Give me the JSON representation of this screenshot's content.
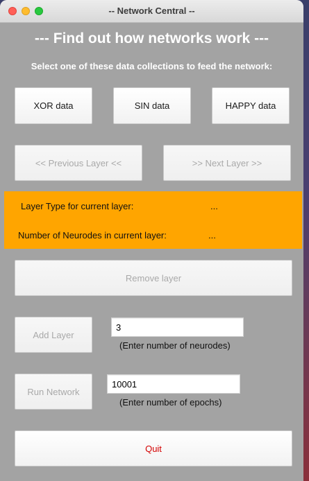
{
  "window": {
    "title": "--  Network Central  --"
  },
  "heading": "---  Find out how networks work  ---",
  "subheading": "Select one of these data collections to feed the network:",
  "data_buttons": [
    {
      "label": "XOR data"
    },
    {
      "label": "SIN data"
    },
    {
      "label": "HAPPY data"
    }
  ],
  "layer_nav": {
    "previous_label": "<<  Previous Layer  <<",
    "next_label": ">>  Next Layer  >>",
    "enabled": false
  },
  "layer_info": {
    "type_label": "Layer Type for current layer:",
    "type_value": "...",
    "neurodes_label": "Number of Neurodes in current layer:",
    "neurodes_value": "...",
    "panel_color": "#ffa500"
  },
  "remove_layer": {
    "label": "Remove layer",
    "enabled": false
  },
  "add_layer": {
    "label": "Add Layer",
    "enabled": false,
    "input_value": "3",
    "hint": "(Enter number of neurodes)"
  },
  "run_network": {
    "label": "Run Network",
    "enabled": false,
    "input_value": "10001",
    "hint": "(Enter number of epochs)"
  },
  "quit": {
    "label": "Quit",
    "color": "#d40000"
  }
}
